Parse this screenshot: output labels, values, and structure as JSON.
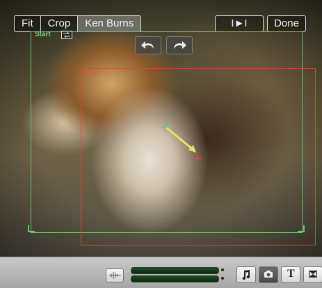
{
  "toolbar_top": {
    "fit_label": "Fit",
    "crop_label": "Crop",
    "ken_burns_label": "Ken Burns",
    "play_label": "I►I",
    "done_label": "Done"
  },
  "frames": {
    "start_label": "Start",
    "end_label": "End"
  },
  "colors": {
    "start_frame": "#69c46a",
    "end_frame": "#d34b3a",
    "motion_arrow": "#e6e06b"
  },
  "icons": {
    "rotate_left": "rotate-left-icon",
    "rotate_right": "rotate-right-icon",
    "swap": "swap-icon",
    "waveform": "waveform-icon",
    "music": "music-note-icon",
    "camera": "camera-icon",
    "text": "text-icon",
    "transition": "transition-icon"
  },
  "bottom_bar": {
    "text_tool_label": "T"
  }
}
